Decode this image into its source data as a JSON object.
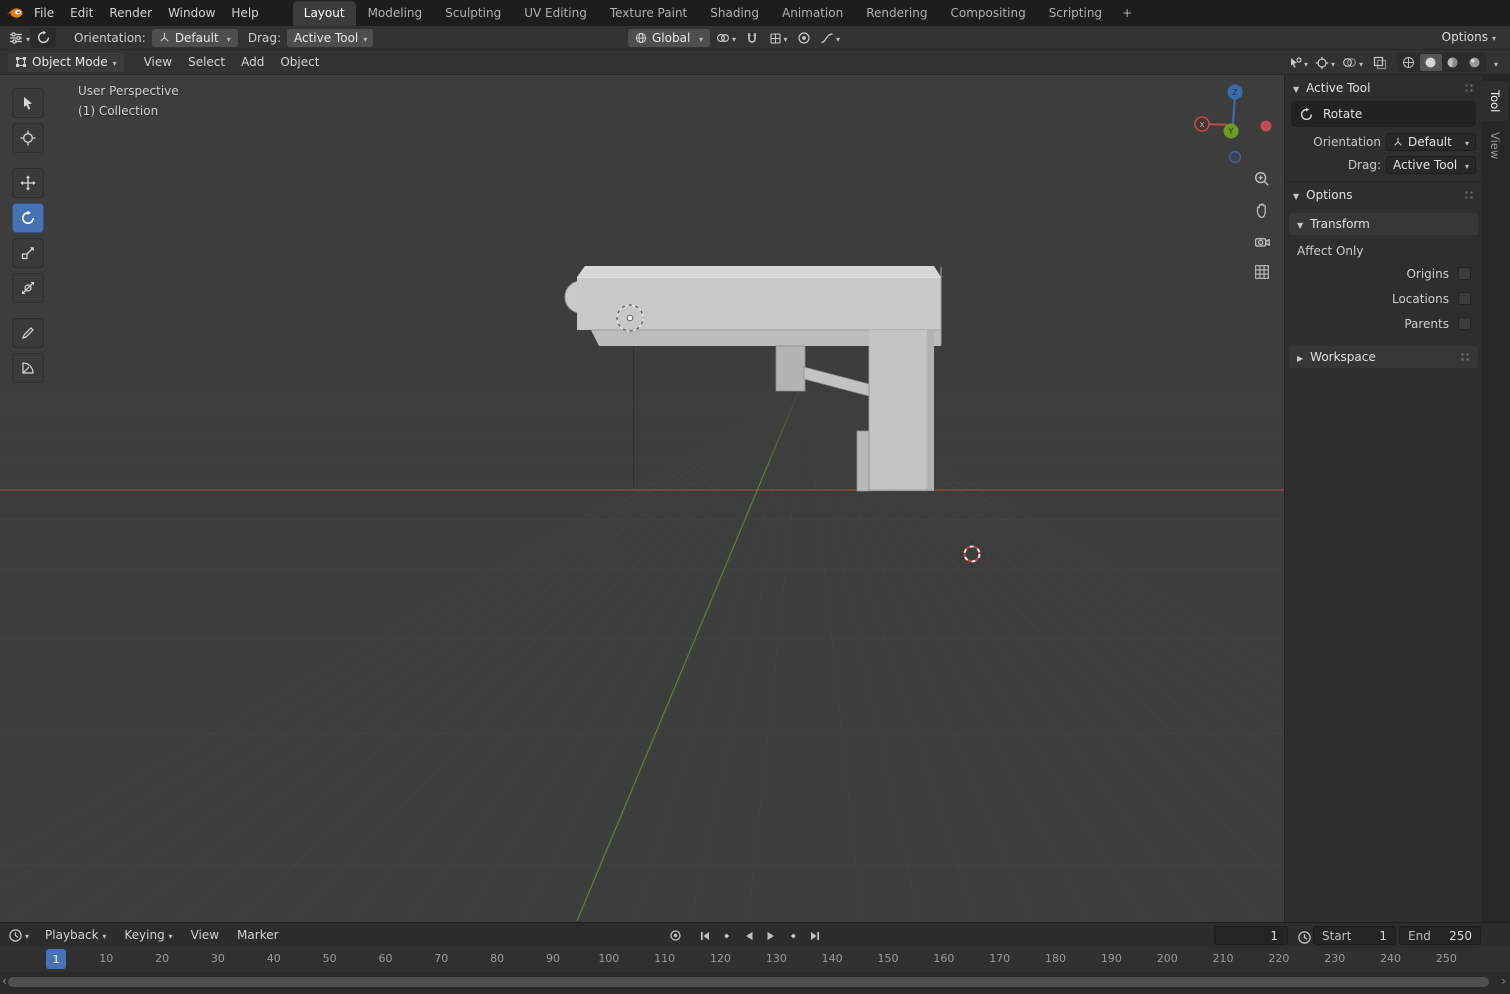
{
  "colors": {
    "accent": "#4772b3",
    "topbar_bg": "#1d1d1d",
    "header_bg": "#323232",
    "viewport_bg": "#3d3d3d",
    "panel_bg": "#2e2e2e",
    "axis_x": "#a84c48",
    "axis_y": "#5e8b28",
    "model_gray": "#c7c7c7"
  },
  "topbar": {
    "menus": [
      "File",
      "Edit",
      "Render",
      "Window",
      "Help"
    ],
    "tabs": [
      "Layout",
      "Modeling",
      "Sculpting",
      "UV Editing",
      "Texture Paint",
      "Shading",
      "Animation",
      "Rendering",
      "Compositing",
      "Scripting"
    ],
    "active_tab": "Layout",
    "new_tab_label": "+"
  },
  "tool_header": {
    "orientation_label": "Orientation:",
    "orientation_value": "Default",
    "drag_label": "Drag:",
    "drag_value": "Active Tool",
    "transform_orientation_value": "Global",
    "options_label": "Options"
  },
  "viewport_header": {
    "mode_value": "Object Mode",
    "menus": [
      "View",
      "Select",
      "Add",
      "Object"
    ]
  },
  "viewport": {
    "view_label": "User Perspective",
    "collection_label": "(1) Collection",
    "gizmo_axes": {
      "x": "X",
      "y": "Y",
      "z": "Z"
    }
  },
  "sidebar": {
    "tabs": [
      "Tool",
      "View"
    ],
    "active_tab": "Tool",
    "active_tool_header": "Active Tool",
    "tool_name": "Rotate",
    "orientation_label": "Orientation",
    "orientation_value": "Default",
    "drag_label": "Drag:",
    "drag_value": "Active Tool",
    "options_header": "Options",
    "transform_header": "Transform",
    "affect_only_label": "Affect Only",
    "toggles": [
      "Origins",
      "Locations",
      "Parents"
    ],
    "workspace_header": "Workspace"
  },
  "timeline": {
    "menus": [
      "Playback",
      "Keying",
      "View",
      "Marker"
    ],
    "current_frame": "1",
    "start_label": "Start",
    "start_value": "1",
    "end_label": "End",
    "end_value": "250",
    "marker_label": "1",
    "ruler_ticks": [
      "10",
      "20",
      "30",
      "40",
      "50",
      "60",
      "70",
      "80",
      "90",
      "100",
      "110",
      "120",
      "130",
      "140",
      "150",
      "160",
      "170",
      "180",
      "190",
      "200",
      "210",
      "220",
      "230",
      "240",
      "250"
    ]
  }
}
